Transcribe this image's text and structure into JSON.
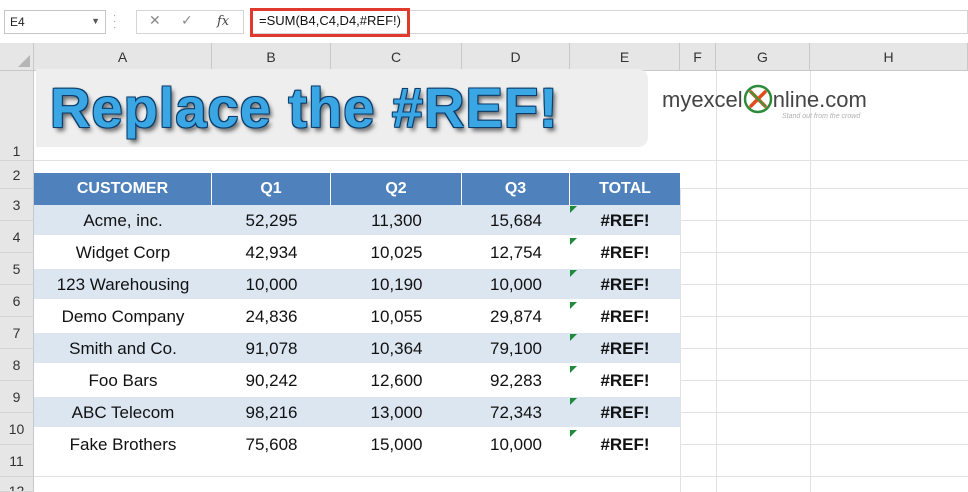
{
  "formula_bar": {
    "name_box": "E4",
    "formula": "=SUM(B4,C4,D4,#REF!)",
    "icons": [
      "cancel-icon",
      "enter-icon",
      "fx-icon"
    ],
    "highlight_color": "#e03a2f"
  },
  "sheet": {
    "columns": [
      "A",
      "B",
      "C",
      "D",
      "E",
      "F",
      "G",
      "H"
    ],
    "rows": [
      "1",
      "2",
      "3",
      "4",
      "5",
      "6",
      "7",
      "8",
      "9",
      "10",
      "11",
      "12"
    ],
    "banner_title": "Replace the #REF!",
    "logo": {
      "text_before": "myexcel",
      "text_after": "nline.com",
      "tagline": "Stand out from the crowd"
    },
    "table": {
      "headers": [
        "CUSTOMER",
        "Q1",
        "Q2",
        "Q3",
        "TOTAL"
      ],
      "rows": [
        [
          "Acme, inc.",
          "52,295",
          "11,300",
          "15,684",
          "#REF!"
        ],
        [
          "Widget Corp",
          "42,934",
          "10,025",
          "12,754",
          "#REF!"
        ],
        [
          "123 Warehousing",
          "10,000",
          "10,190",
          "10,000",
          "#REF!"
        ],
        [
          "Demo Company",
          "24,836",
          "10,055",
          "29,874",
          "#REF!"
        ],
        [
          "Smith and Co.",
          "91,078",
          "10,364",
          "79,100",
          "#REF!"
        ],
        [
          "Foo Bars",
          "90,242",
          "12,600",
          "92,283",
          "#REF!"
        ],
        [
          "ABC Telecom",
          "98,216",
          "13,000",
          "72,343",
          "#REF!"
        ],
        [
          "Fake Brothers",
          "75,608",
          "15,000",
          "10,000",
          "#REF!"
        ]
      ],
      "header_color": "#4f81bd",
      "band_color": "#dce6f1"
    }
  }
}
